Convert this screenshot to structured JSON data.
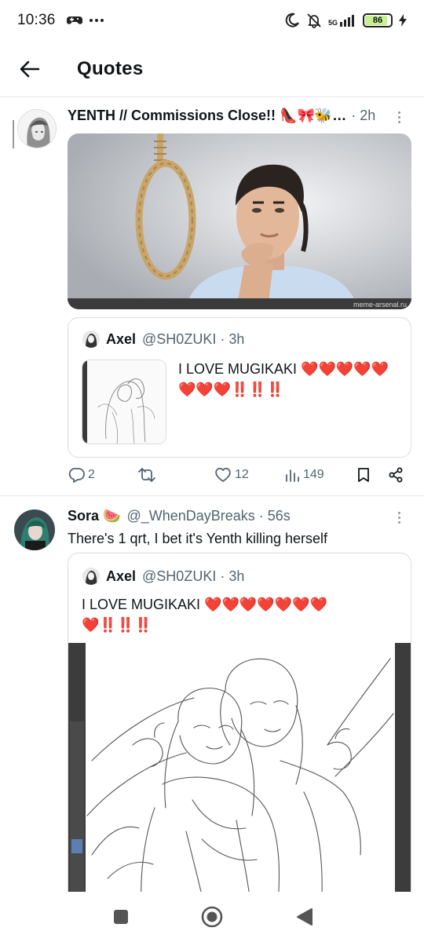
{
  "status": {
    "time": "10:36",
    "network": "5G",
    "battery": "86",
    "battery_level_pct": 86
  },
  "header": {
    "title": "Quotes"
  },
  "tweets": [
    {
      "name": "YENTH // Commissions Close!! 👠🎀🐝…",
      "time": "· 2h",
      "image_watermark": "meme-arsenal.ru",
      "quote": {
        "name": "Axel",
        "handle": "@SH0ZUKI",
        "time": "· 3h",
        "text": "I LOVE MUGIKAKI ❤️❤️❤️❤️❤️❤️❤️❤️‼️‼️‼️"
      },
      "stats": {
        "replies": "2",
        "reposts": "",
        "likes": "12",
        "views": "149"
      }
    },
    {
      "name": "Sora 🍉",
      "handle": "@_WhenDayBreaks",
      "time": "· 56s",
      "text": "There's 1 qrt, I bet it's Yenth killing herself",
      "quote": {
        "name": "Axel",
        "handle": "@SH0ZUKI",
        "time": "· 3h",
        "text_line1": "I LOVE MUGIKAKI ❤️❤️❤️❤️❤️❤️❤️",
        "text_line2": "❤️‼️‼️‼️"
      }
    }
  ],
  "icons": {
    "back": "arrow-left-icon",
    "more": "more-vertical-icon",
    "reply": "comment-icon",
    "repost": "repost-icon",
    "like": "heart-icon",
    "views": "bar-chart-icon",
    "bookmark": "bookmark-icon",
    "share": "share-icon"
  },
  "colors": {
    "text": "#0f1419",
    "muted": "#536471",
    "border": "#e6e8ea"
  }
}
